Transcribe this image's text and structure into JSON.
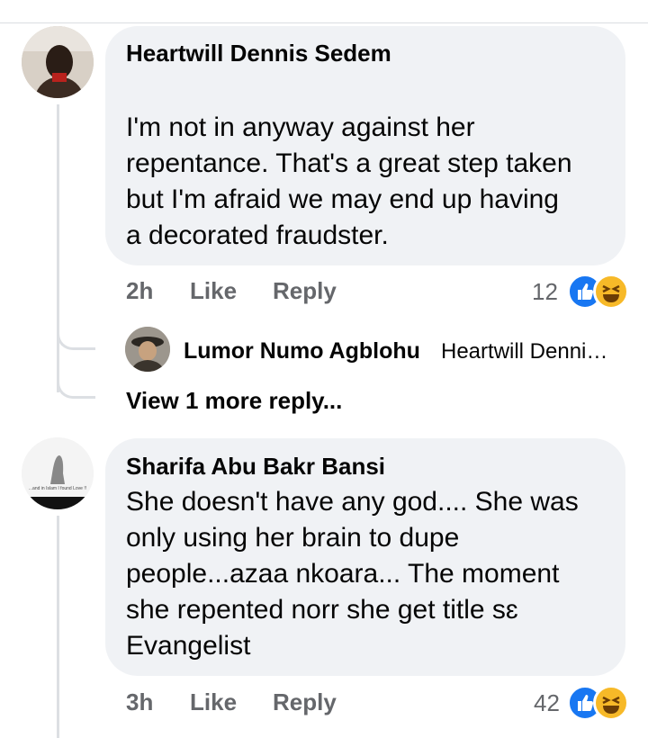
{
  "comments": [
    {
      "author": "Heartwill Dennis Sedem",
      "text_lines": [
        "I'm not in anyway against her",
        "repentance. That's a great step taken",
        "but I'm afraid we may end up having",
        "a decorated fraudster."
      ],
      "time": "2h",
      "like_label": "Like",
      "reply_label": "Reply",
      "reaction_count": "12",
      "reactions": [
        "like-icon",
        "haha-icon"
      ]
    },
    {
      "author": "Sharifa Abu Bakr Bansi",
      "avatar_caption": "...and in Islam I found Love !!",
      "text_lines": [
        "She doesn't have any god.... She was",
        "only using her brain to dupe",
        "people...azaa nkoara... The moment",
        "she repented norr she get title sɛ",
        "Evangelist"
      ],
      "time": "3h",
      "like_label": "Like",
      "reply_label": "Reply",
      "reaction_count": "42",
      "reactions": [
        "like-icon",
        "haha-icon"
      ]
    }
  ],
  "reply_preview": {
    "author": "Lumor Numo Agblohu",
    "text": "Heartwill Denni…"
  },
  "view_more_label": "View 1 more reply...",
  "colors": {
    "bubble": "#f0f2f5",
    "meta_text": "#65676b",
    "like_blue": "#1877f2",
    "haha_yellow": "#f7b928",
    "thread_line": "#dcdfe3"
  }
}
